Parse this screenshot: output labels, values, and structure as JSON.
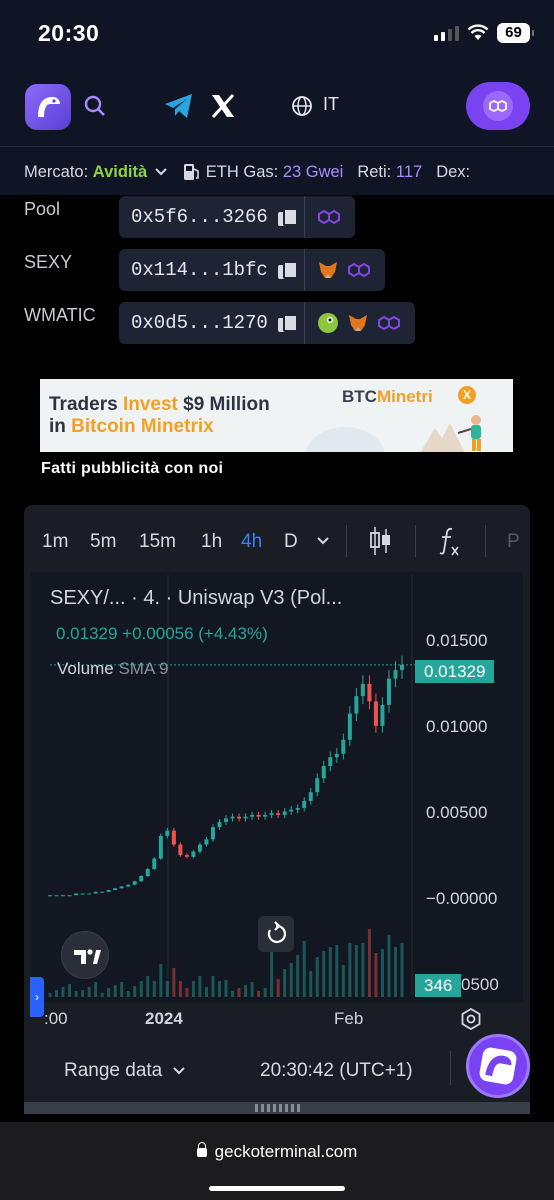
{
  "status_bar": {
    "time": "20:30",
    "battery": "69"
  },
  "nav": {
    "language": "IT"
  },
  "ticker": {
    "market_label": "Mercato:",
    "market_value": "Avidità",
    "gas_label": "ETH Gas:",
    "gas_value": "23 Gwei",
    "networks_label": "Reti:",
    "networks_value": "117",
    "dex_label": "Dex:"
  },
  "tokens": [
    {
      "label": "Pool",
      "address": "0x5f6...3266"
    },
    {
      "label": "SEXY",
      "address": "0x114...1bfc"
    },
    {
      "label": "WMATIC",
      "address": "0x0d5...1270"
    }
  ],
  "banner": {
    "line1_a": "Traders ",
    "line1_b": "Invest",
    "line1_c": " $9 Million",
    "line2_a": "in ",
    "line2_b": "Bitcoin Minetrix",
    "brand_a": "BTC",
    "brand_b": "Minetri",
    "brand_coin": "X"
  },
  "ad_note": "Fatti pubblicità con noi",
  "chart": {
    "timeframes": [
      "1m",
      "5m",
      "15m",
      "1h",
      "4h",
      "D"
    ],
    "active_timeframe": "4h",
    "title": "SEXY/... · 4. · Uniswap V3 (Pol...",
    "price_line": "0.01329 +0.00056 (+4.43%)",
    "volume_label": "Volume",
    "volume_indicator": "SMA 9",
    "last_price_badge": "0.01329",
    "volume_badge": "346",
    "footer_range": "Range data",
    "footer_time": "20:30:42 (UTC+1)",
    "x_ticks": [
      ":00",
      "2024",
      "Feb"
    ],
    "more_tab": "P"
  },
  "chart_data": {
    "type": "candlestick",
    "y_ticks": [
      "0.01500",
      "0.01000",
      "0.00500",
      "−0.00000",
      "0500"
    ],
    "ylim": [
      -0.0045,
      0.017
    ],
    "x_ticks": [
      ":00",
      "2024",
      "Feb"
    ],
    "series": [
      {
        "name": "Price",
        "values": [
          0.0001,
          0.0001,
          0.0001,
          0.0001,
          0.0002,
          0.0002,
          0.0002,
          0.0003,
          0.0003,
          0.0004,
          0.0005,
          0.0006,
          0.0007,
          0.0009,
          0.0012,
          0.0016,
          0.0022,
          0.0035,
          0.0038,
          0.003,
          0.0024,
          0.0023,
          0.0026,
          0.003,
          0.0033,
          0.004,
          0.0043,
          0.0045,
          0.0046,
          0.0045,
          0.0046,
          0.0047,
          0.0046,
          0.0047,
          0.0048,
          0.0047,
          0.0049,
          0.005,
          0.0051,
          0.0055,
          0.006,
          0.0068,
          0.0075,
          0.008,
          0.0082,
          0.009,
          0.0105,
          0.0115,
          0.0122,
          0.0112,
          0.0098,
          0.011,
          0.0125,
          0.013,
          0.01329
        ]
      }
    ],
    "last_value": 0.01329,
    "volume_last": 346
  },
  "url": "geckoterminal.com",
  "colors": {
    "accent": "#7a43f1",
    "up": "#26a69a",
    "down": "#ef5350",
    "market_green": "#8dd14a"
  }
}
